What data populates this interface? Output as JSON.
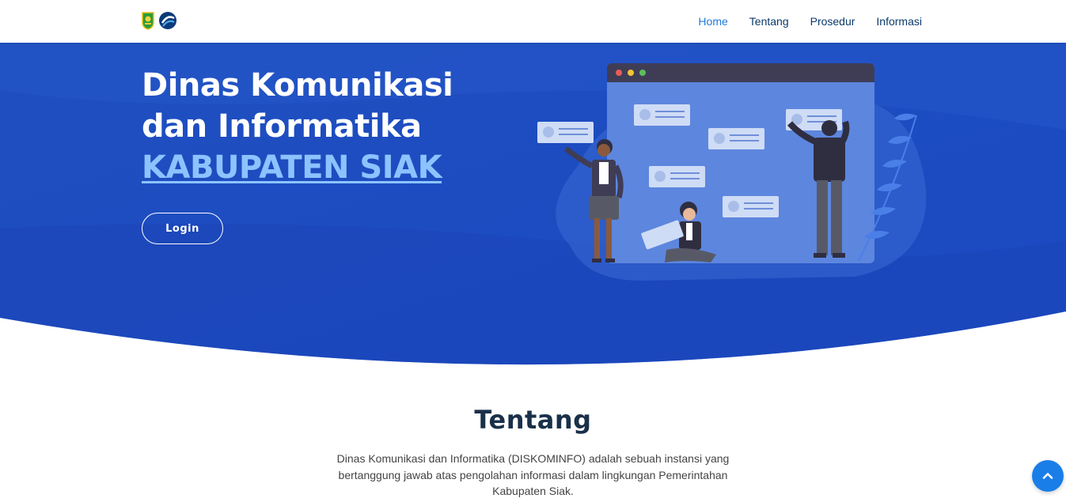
{
  "nav": {
    "logos": [
      "kabupaten-siak-logo",
      "kominfo-logo"
    ],
    "links": [
      {
        "label": "Home",
        "active": true
      },
      {
        "label": "Tentang",
        "active": false
      },
      {
        "label": "Prosedur",
        "active": false
      },
      {
        "label": "Informasi",
        "active": false
      }
    ]
  },
  "hero": {
    "title_line1": "Dinas Komunikasi",
    "title_line2": "dan Informatika",
    "title_accent": "KABUPATEN SIAK",
    "login_label": "Login",
    "illustration": "team-collaboration-board-illustration"
  },
  "about": {
    "title": "Tentang",
    "text": "Dinas Komunikasi dan Informatika (DISKOMINFO) adalah sebuah instansi yang bertanggung jawab atas pengolahan informasi dalam lingkungan Pemerintahan Kabupaten Siak."
  },
  "back_to_top": {
    "icon": "chevron-up-icon"
  },
  "colors": {
    "hero_blue": "#1d4fc4",
    "accent_light_blue": "#8cc3ff",
    "nav_active": "#1f7ad8",
    "button_blue": "#1a7ee8"
  }
}
